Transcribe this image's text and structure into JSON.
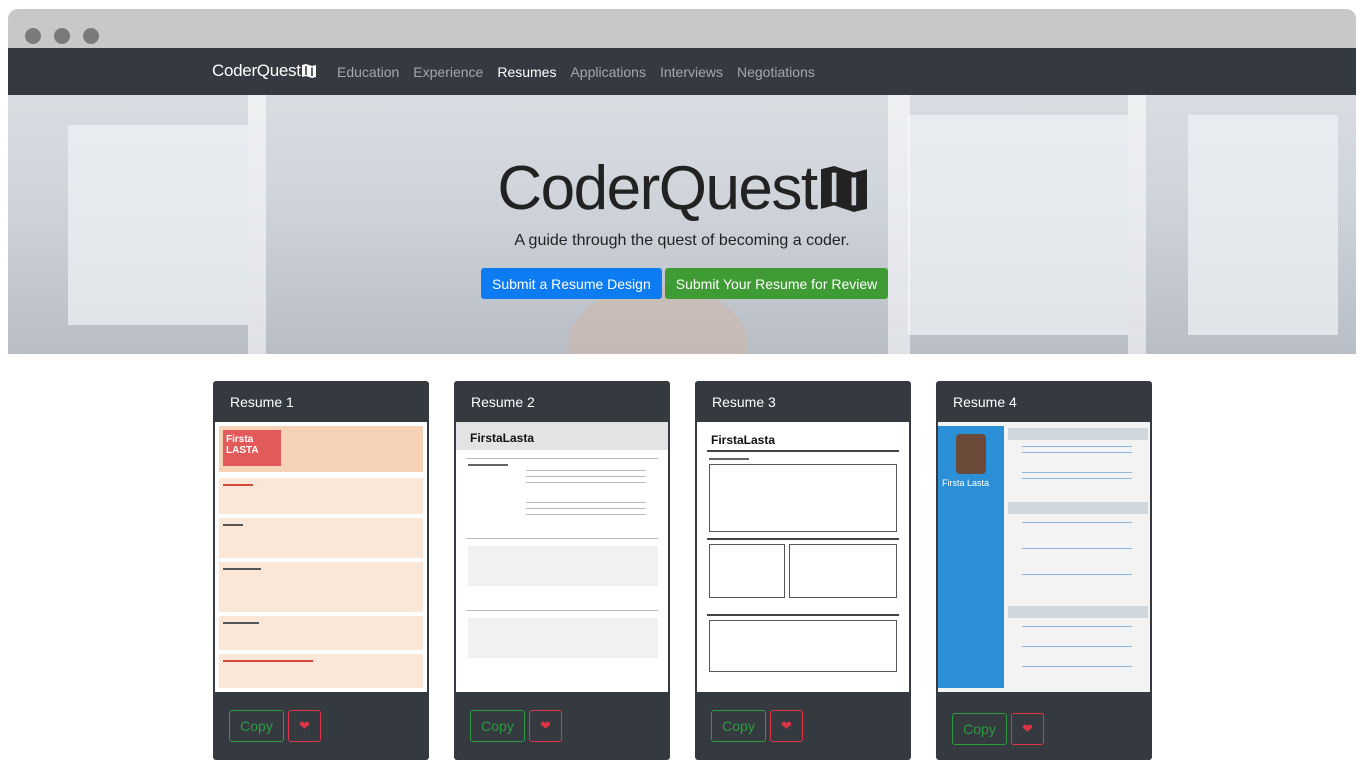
{
  "navbar": {
    "brand": "CoderQuest",
    "links": [
      "Education",
      "Experience",
      "Resumes",
      "Applications",
      "Interviews",
      "Negotiations"
    ],
    "active": "Resumes"
  },
  "hero": {
    "title": "CoderQuest",
    "subtitle": "A guide through the quest of becoming a coder.",
    "primary_button": "Submit a Resume Design",
    "secondary_button": "Submit Your Resume for Review"
  },
  "cards": [
    {
      "title": "Resume 1",
      "copy_label": "Copy",
      "thumb_name": "Firsta LASTA"
    },
    {
      "title": "Resume 2",
      "copy_label": "Copy",
      "thumb_name": "FirstaLasta"
    },
    {
      "title": "Resume 3",
      "copy_label": "Copy",
      "thumb_name": "FirstaLasta"
    },
    {
      "title": "Resume 4",
      "copy_label": "Copy",
      "thumb_name": "Firsta Lasta"
    }
  ],
  "colors": {
    "navbar_bg": "#343a40",
    "primary": "#0d7bf2",
    "success": "#3f9c35",
    "danger": "#dc3545"
  },
  "icons": {
    "brand": "map-icon",
    "like": "heart-icon"
  }
}
